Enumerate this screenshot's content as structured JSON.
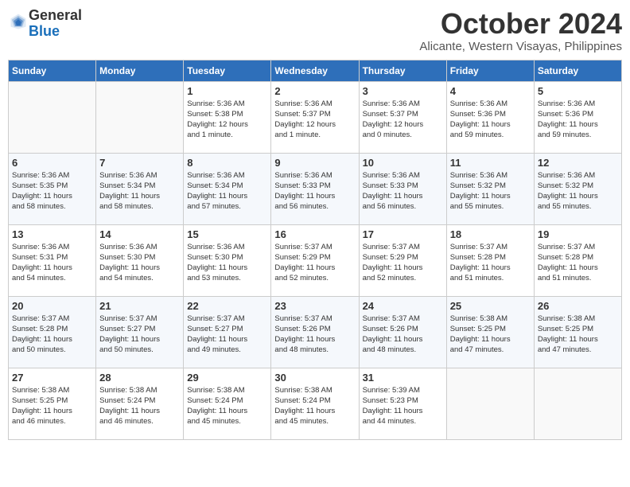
{
  "header": {
    "logo_general": "General",
    "logo_blue": "Blue",
    "month_title": "October 2024",
    "location": "Alicante, Western Visayas, Philippines"
  },
  "weekdays": [
    "Sunday",
    "Monday",
    "Tuesday",
    "Wednesday",
    "Thursday",
    "Friday",
    "Saturday"
  ],
  "weeks": [
    [
      {
        "day": "",
        "info": ""
      },
      {
        "day": "",
        "info": ""
      },
      {
        "day": "1",
        "info": "Sunrise: 5:36 AM\nSunset: 5:38 PM\nDaylight: 12 hours\nand 1 minute."
      },
      {
        "day": "2",
        "info": "Sunrise: 5:36 AM\nSunset: 5:37 PM\nDaylight: 12 hours\nand 1 minute."
      },
      {
        "day": "3",
        "info": "Sunrise: 5:36 AM\nSunset: 5:37 PM\nDaylight: 12 hours\nand 0 minutes."
      },
      {
        "day": "4",
        "info": "Sunrise: 5:36 AM\nSunset: 5:36 PM\nDaylight: 11 hours\nand 59 minutes."
      },
      {
        "day": "5",
        "info": "Sunrise: 5:36 AM\nSunset: 5:36 PM\nDaylight: 11 hours\nand 59 minutes."
      }
    ],
    [
      {
        "day": "6",
        "info": "Sunrise: 5:36 AM\nSunset: 5:35 PM\nDaylight: 11 hours\nand 58 minutes."
      },
      {
        "day": "7",
        "info": "Sunrise: 5:36 AM\nSunset: 5:34 PM\nDaylight: 11 hours\nand 58 minutes."
      },
      {
        "day": "8",
        "info": "Sunrise: 5:36 AM\nSunset: 5:34 PM\nDaylight: 11 hours\nand 57 minutes."
      },
      {
        "day": "9",
        "info": "Sunrise: 5:36 AM\nSunset: 5:33 PM\nDaylight: 11 hours\nand 56 minutes."
      },
      {
        "day": "10",
        "info": "Sunrise: 5:36 AM\nSunset: 5:33 PM\nDaylight: 11 hours\nand 56 minutes."
      },
      {
        "day": "11",
        "info": "Sunrise: 5:36 AM\nSunset: 5:32 PM\nDaylight: 11 hours\nand 55 minutes."
      },
      {
        "day": "12",
        "info": "Sunrise: 5:36 AM\nSunset: 5:32 PM\nDaylight: 11 hours\nand 55 minutes."
      }
    ],
    [
      {
        "day": "13",
        "info": "Sunrise: 5:36 AM\nSunset: 5:31 PM\nDaylight: 11 hours\nand 54 minutes."
      },
      {
        "day": "14",
        "info": "Sunrise: 5:36 AM\nSunset: 5:30 PM\nDaylight: 11 hours\nand 54 minutes."
      },
      {
        "day": "15",
        "info": "Sunrise: 5:36 AM\nSunset: 5:30 PM\nDaylight: 11 hours\nand 53 minutes."
      },
      {
        "day": "16",
        "info": "Sunrise: 5:37 AM\nSunset: 5:29 PM\nDaylight: 11 hours\nand 52 minutes."
      },
      {
        "day": "17",
        "info": "Sunrise: 5:37 AM\nSunset: 5:29 PM\nDaylight: 11 hours\nand 52 minutes."
      },
      {
        "day": "18",
        "info": "Sunrise: 5:37 AM\nSunset: 5:28 PM\nDaylight: 11 hours\nand 51 minutes."
      },
      {
        "day": "19",
        "info": "Sunrise: 5:37 AM\nSunset: 5:28 PM\nDaylight: 11 hours\nand 51 minutes."
      }
    ],
    [
      {
        "day": "20",
        "info": "Sunrise: 5:37 AM\nSunset: 5:28 PM\nDaylight: 11 hours\nand 50 minutes."
      },
      {
        "day": "21",
        "info": "Sunrise: 5:37 AM\nSunset: 5:27 PM\nDaylight: 11 hours\nand 50 minutes."
      },
      {
        "day": "22",
        "info": "Sunrise: 5:37 AM\nSunset: 5:27 PM\nDaylight: 11 hours\nand 49 minutes."
      },
      {
        "day": "23",
        "info": "Sunrise: 5:37 AM\nSunset: 5:26 PM\nDaylight: 11 hours\nand 48 minutes."
      },
      {
        "day": "24",
        "info": "Sunrise: 5:37 AM\nSunset: 5:26 PM\nDaylight: 11 hours\nand 48 minutes."
      },
      {
        "day": "25",
        "info": "Sunrise: 5:38 AM\nSunset: 5:25 PM\nDaylight: 11 hours\nand 47 minutes."
      },
      {
        "day": "26",
        "info": "Sunrise: 5:38 AM\nSunset: 5:25 PM\nDaylight: 11 hours\nand 47 minutes."
      }
    ],
    [
      {
        "day": "27",
        "info": "Sunrise: 5:38 AM\nSunset: 5:25 PM\nDaylight: 11 hours\nand 46 minutes."
      },
      {
        "day": "28",
        "info": "Sunrise: 5:38 AM\nSunset: 5:24 PM\nDaylight: 11 hours\nand 46 minutes."
      },
      {
        "day": "29",
        "info": "Sunrise: 5:38 AM\nSunset: 5:24 PM\nDaylight: 11 hours\nand 45 minutes."
      },
      {
        "day": "30",
        "info": "Sunrise: 5:38 AM\nSunset: 5:24 PM\nDaylight: 11 hours\nand 45 minutes."
      },
      {
        "day": "31",
        "info": "Sunrise: 5:39 AM\nSunset: 5:23 PM\nDaylight: 11 hours\nand 44 minutes."
      },
      {
        "day": "",
        "info": ""
      },
      {
        "day": "",
        "info": ""
      }
    ]
  ]
}
